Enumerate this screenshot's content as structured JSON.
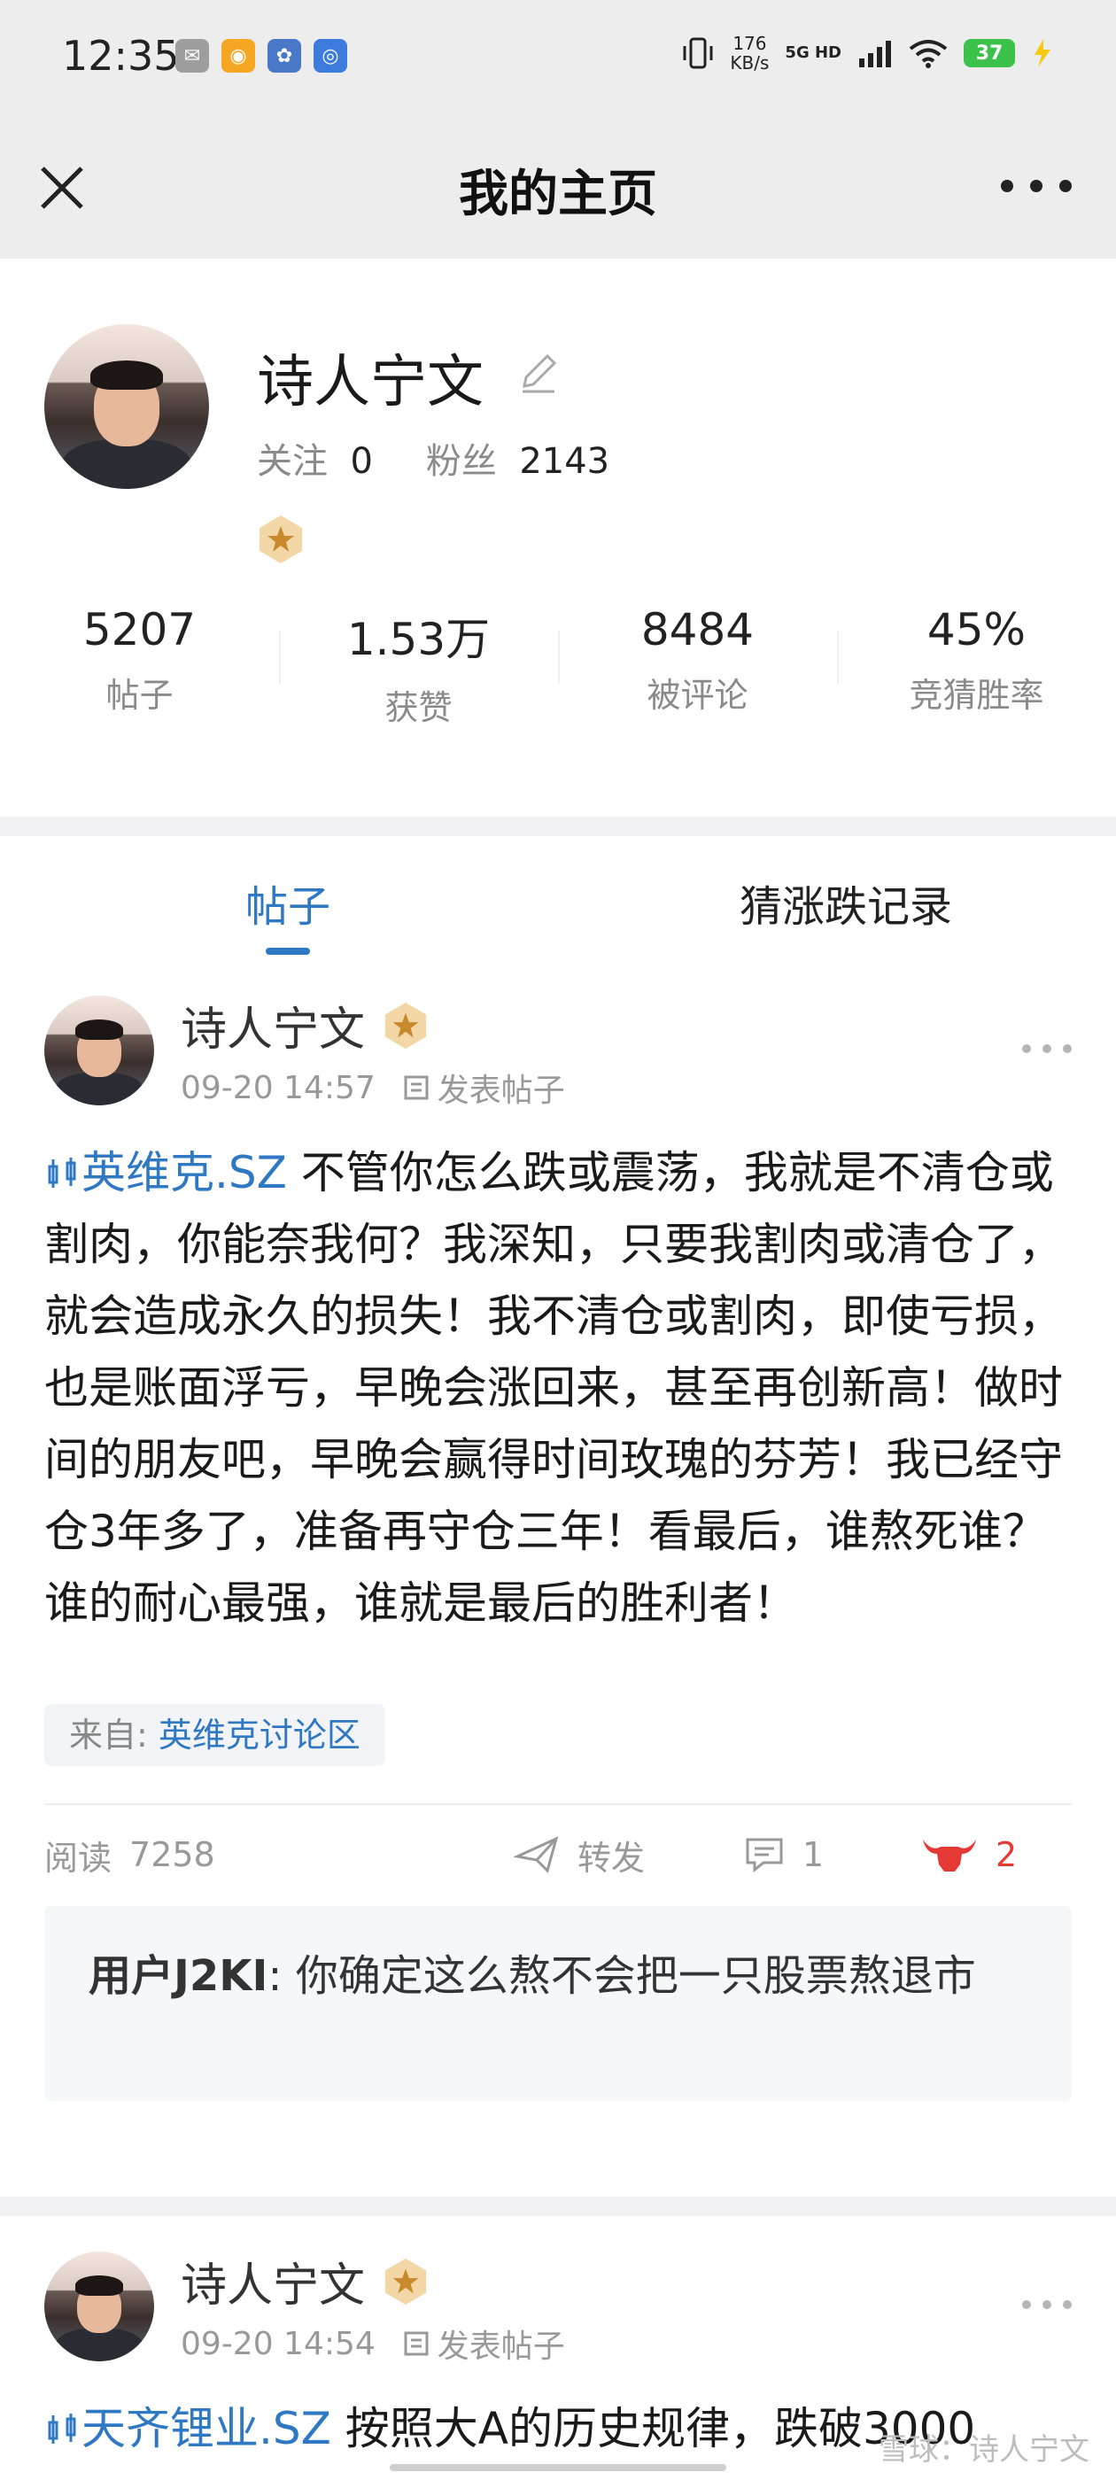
{
  "status_bar": {
    "time": "12:35",
    "speed_value": "176",
    "speed_unit": "KB/s",
    "network": "5G HD",
    "battery": "37",
    "app_icons": [
      "wechat-icon",
      "weibo-icon",
      "app-icon",
      "qq-icon"
    ]
  },
  "header": {
    "title": "我的主页"
  },
  "profile": {
    "name": "诗人宁文",
    "follow_label": "关注",
    "follow_count": "0",
    "fans_label": "粉丝",
    "fans_count": "2143",
    "stats": [
      {
        "value": "5207",
        "label": "帖子"
      },
      {
        "value": "1.53万",
        "label": "获赞"
      },
      {
        "value": "8484",
        "label": "被评论"
      },
      {
        "value": "45%",
        "label": "竞猜胜率"
      }
    ]
  },
  "tabs": [
    {
      "label": "帖子",
      "active": true
    },
    {
      "label": "猜涨跌记录",
      "active": false
    }
  ],
  "posts": [
    {
      "author": "诗人宁文",
      "time": "09-20 14:57",
      "type": "发表帖子",
      "stock": "英维克.SZ",
      "text": " 不管你怎么跌或震荡，我就是不清仓或割肉，你能奈我何？我深知，只要我割肉或清仓了，就会造成永久的损失！我不清仓或割肉，即使亏损，也是账面浮亏，早晚会涨回来，甚至再创新高！做时间的朋友吧，早晚会赢得时间玫瑰的芬芳！我已经守仓3年多了，准备再守仓三年！看最后，谁熬死谁？谁的耐心最强，谁就是最后的胜利者！",
      "source_label": "来自:",
      "source_name": "英维克讨论区",
      "read_label": "阅读",
      "read_count": "7258",
      "share_label": "转发",
      "comment_count": "1",
      "like_count": "2",
      "top_comment_user": "用户J2KI",
      "top_comment_text": "你确定这么熬不会把一只股票熬退市"
    },
    {
      "author": "诗人宁文",
      "time": "09-20 14:54",
      "type": "发表帖子",
      "stock": "天齐锂业.SZ",
      "text": " 按照大A的历史规律，跌破3000"
    }
  ],
  "watermark": "雪球：诗人宁文",
  "colors": {
    "accent": "#2f78c3",
    "like": "#e53935",
    "header_bg": "#ededed"
  }
}
